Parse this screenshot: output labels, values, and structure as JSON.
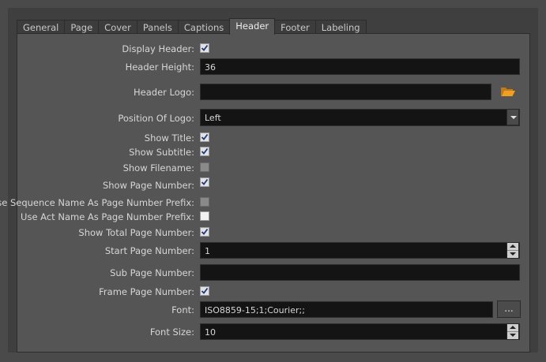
{
  "tabs": [
    {
      "label": "General"
    },
    {
      "label": "Page"
    },
    {
      "label": "Cover"
    },
    {
      "label": "Panels"
    },
    {
      "label": "Captions"
    },
    {
      "label": "Header",
      "active": true
    },
    {
      "label": "Footer"
    },
    {
      "label": "Labeling"
    }
  ],
  "form": {
    "display_header": {
      "label": "Display Header:",
      "checked": true
    },
    "header_height": {
      "label": "Header Height:",
      "value": "36"
    },
    "header_logo": {
      "label": "Header Logo:",
      "value": ""
    },
    "position_of_logo": {
      "label": "Position Of Logo:",
      "value": "Left"
    },
    "show_title": {
      "label": "Show Title:",
      "checked": true
    },
    "show_subtitle": {
      "label": "Show Subtitle:",
      "checked": true
    },
    "show_filename": {
      "label": "Show Filename:",
      "checked": false
    },
    "show_page_number": {
      "label": "Show Page Number:",
      "checked": true
    },
    "use_sequence_name": {
      "label": "Use Sequence Name As Page Number Prefix:",
      "checked": false
    },
    "use_act_name": {
      "label": "Use Act Name As Page Number Prefix:",
      "checked": false
    },
    "show_total_page_number": {
      "label": "Show Total Page Number:",
      "checked": true
    },
    "start_page_number": {
      "label": "Start Page Number:",
      "value": "1"
    },
    "sub_page_number": {
      "label": "Sub Page Number:",
      "value": ""
    },
    "frame_page_number": {
      "label": "Frame Page Number:",
      "checked": true
    },
    "font": {
      "label": "Font:",
      "value": "ISO8859-15;1;Courier;;",
      "browse_label": "..."
    },
    "font_size": {
      "label": "Font Size:",
      "value": "10"
    }
  },
  "icons": {
    "logo_browse": "folder-open-icon"
  },
  "colors": {
    "background": "#4a4a4a",
    "panel": "#555555",
    "field": "#141414",
    "folder": "#f0a020"
  }
}
